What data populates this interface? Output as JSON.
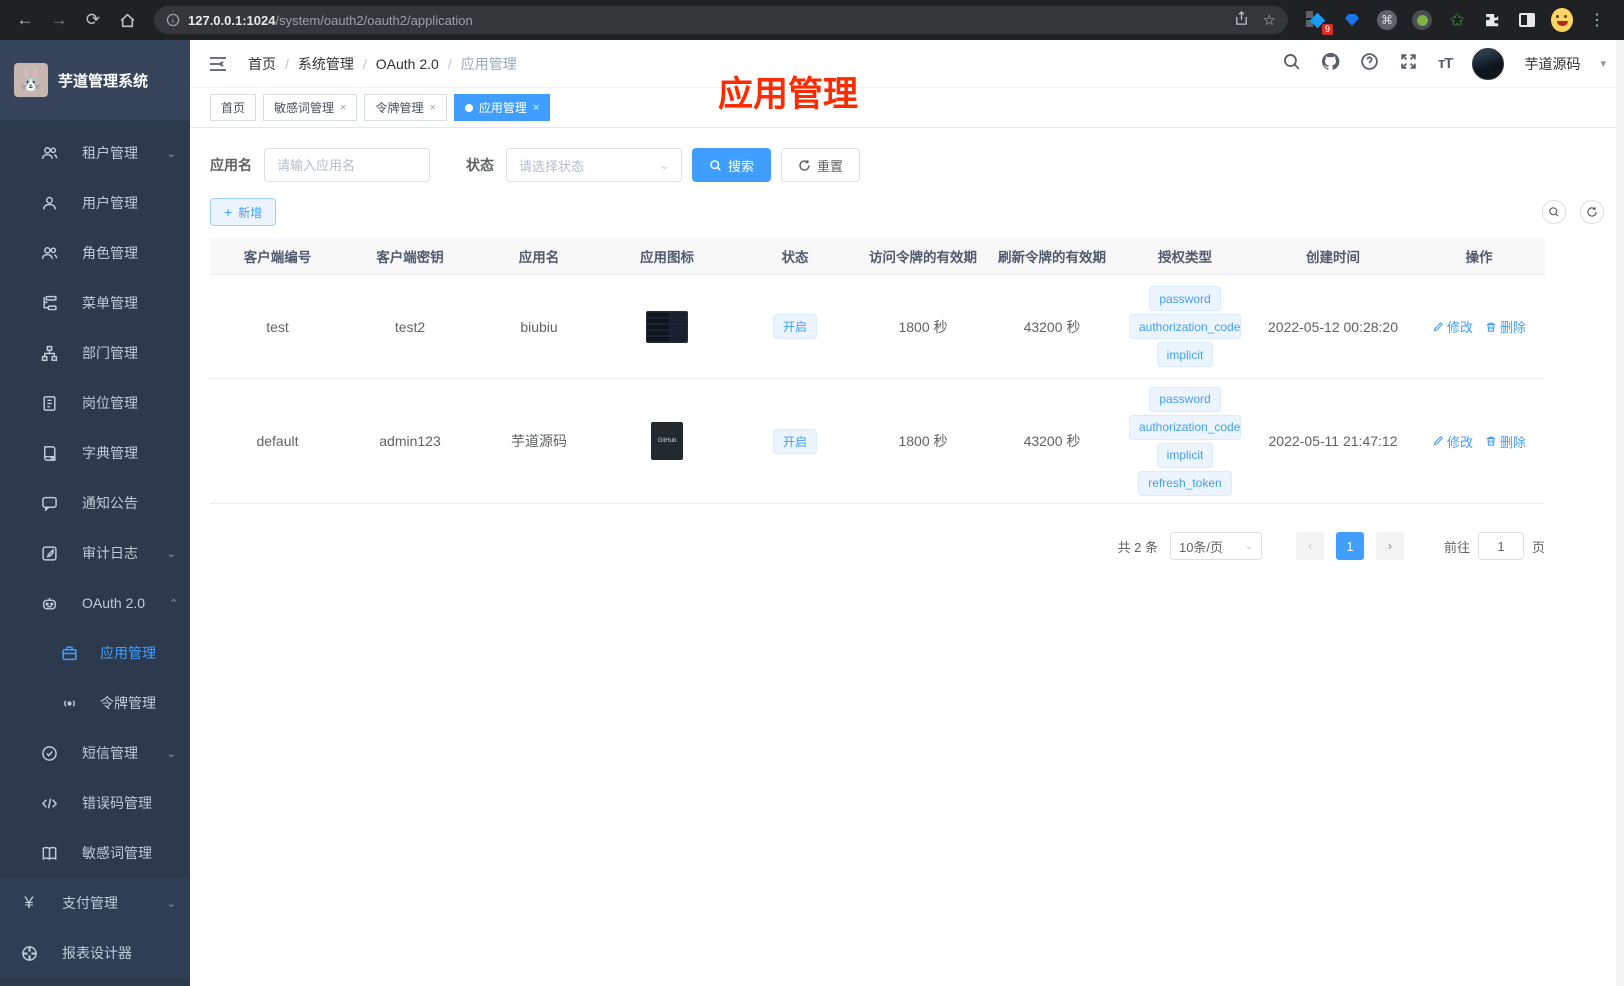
{
  "browser": {
    "url_host": "127.0.0.1:1024",
    "url_path": "/system/oauth2/oauth2/application",
    "extension_badge": "9"
  },
  "sidebar": {
    "title": "芋道管理系统",
    "menu": [
      {
        "label": "租户管理"
      },
      {
        "label": "用户管理"
      },
      {
        "label": "角色管理"
      },
      {
        "label": "菜单管理"
      },
      {
        "label": "部门管理"
      },
      {
        "label": "岗位管理"
      },
      {
        "label": "字典管理"
      },
      {
        "label": "通知公告"
      },
      {
        "label": "审计日志"
      },
      {
        "label": "OAuth 2.0"
      },
      {
        "label": "应用管理"
      },
      {
        "label": "令牌管理"
      },
      {
        "label": "短信管理"
      },
      {
        "label": "错误码管理"
      },
      {
        "label": "敏感词管理"
      },
      {
        "label": "支付管理"
      },
      {
        "label": "报表设计器"
      }
    ]
  },
  "header": {
    "breadcrumb": [
      "首页",
      "系统管理",
      "OAuth 2.0",
      "应用管理"
    ],
    "username": "芋道源码"
  },
  "tabs": {
    "t0": "首页",
    "t1": "敏感词管理",
    "t2": "令牌管理",
    "t3": "应用管理"
  },
  "annotation": "应用管理",
  "filters": {
    "name_label": "应用名",
    "name_placeholder": "请输入应用名",
    "status_label": "状态",
    "status_placeholder": "请选择状态",
    "search_label": "搜索",
    "reset_label": "重置"
  },
  "toolbar": {
    "add_label": "新增"
  },
  "table": {
    "headers": {
      "client_id": "客户端编号",
      "client_secret": "客户端密钥",
      "name": "应用名",
      "icon": "应用图标",
      "status": "状态",
      "access_validity": "访问令牌的有效期",
      "refresh_validity": "刷新令牌的有效期",
      "grant_types": "授权类型",
      "created": "创建时间",
      "actions": "操作"
    },
    "rows": [
      {
        "client_id": "test",
        "client_secret": "test2",
        "name": "biubiu",
        "status": "开启",
        "access_validity": "1800 秒",
        "refresh_validity": "43200 秒",
        "grants": [
          "password",
          "authorization_code",
          "implicit"
        ],
        "created": "2022-05-12 00:28:20"
      },
      {
        "client_id": "default",
        "client_secret": "admin123",
        "name": "芋道源码",
        "status": "开启",
        "access_validity": "1800 秒",
        "refresh_validity": "43200 秒",
        "grants": [
          "password",
          "authorization_code",
          "implicit",
          "refresh_token"
        ],
        "created": "2022-05-11 21:47:12"
      }
    ],
    "edit_label": "修改",
    "delete_label": "删除"
  },
  "pagination": {
    "total": "共 2 条",
    "page_size": "10条/页",
    "current_page": "1",
    "goto_label": "前往",
    "goto_value": "1",
    "page_unit": "页"
  }
}
